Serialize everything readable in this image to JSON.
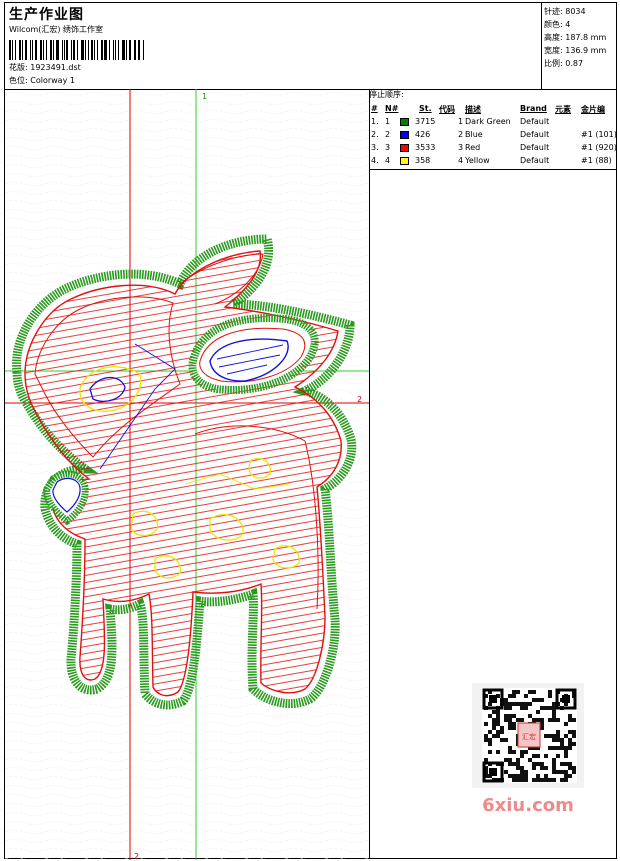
{
  "header": {
    "title": "生产作业图",
    "subtitle": "Wilcom(汇宏) 绣饰工作室",
    "design_label": "花版:",
    "design_value": "1923491.dst",
    "colorway_label": "色位:",
    "colorway_value": "Colorway 1"
  },
  "stats": {
    "stitches": "针迹: 8034",
    "colors": "颜色: 4",
    "height": "高度: 187.8 mm",
    "width": "宽度: 136.9 mm",
    "scale": "比例: 0.87"
  },
  "stop_sequence": {
    "title": "停止顺序:",
    "headers": {
      "index": "#",
      "number": "N#",
      "stitch": "St.",
      "code": "代码",
      "description": "描述",
      "brand": "Brand",
      "element": "元素",
      "sequin": "金片编"
    },
    "rows": [
      {
        "index": "1.",
        "number": "1",
        "color": "#008000",
        "stitch": "3715",
        "code": "1",
        "description": "Dark Green",
        "brand": "Default",
        "element": ""
      },
      {
        "index": "2.",
        "number": "2",
        "color": "#0000ff",
        "stitch": "426",
        "code": "2",
        "description": "Blue",
        "brand": "Default",
        "element": "#1 (101)"
      },
      {
        "index": "3.",
        "number": "3",
        "color": "#ff0000",
        "stitch": "3533",
        "code": "3",
        "description": "Red",
        "brand": "Default",
        "element": "#1 (920)"
      },
      {
        "index": "4.",
        "number": "4",
        "color": "#ffff00",
        "stitch": "358",
        "code": "4",
        "description": "Yellow",
        "brand": "Default",
        "element": "#1 (88)"
      }
    ]
  },
  "canvas": {
    "guide_label_1": "1",
    "guide_label_2_right": "2",
    "guide_label_2_bottom": "2",
    "colors": {
      "green": "#2a9a1e",
      "red": "#e01010",
      "blue": "#1010e0",
      "yellow": "#e8e800",
      "guide_green": "#33cc33",
      "guide_red": "#dd0000"
    }
  },
  "watermark": {
    "qr_stamp_text": "汇宏",
    "site": "6xiu.com"
  }
}
